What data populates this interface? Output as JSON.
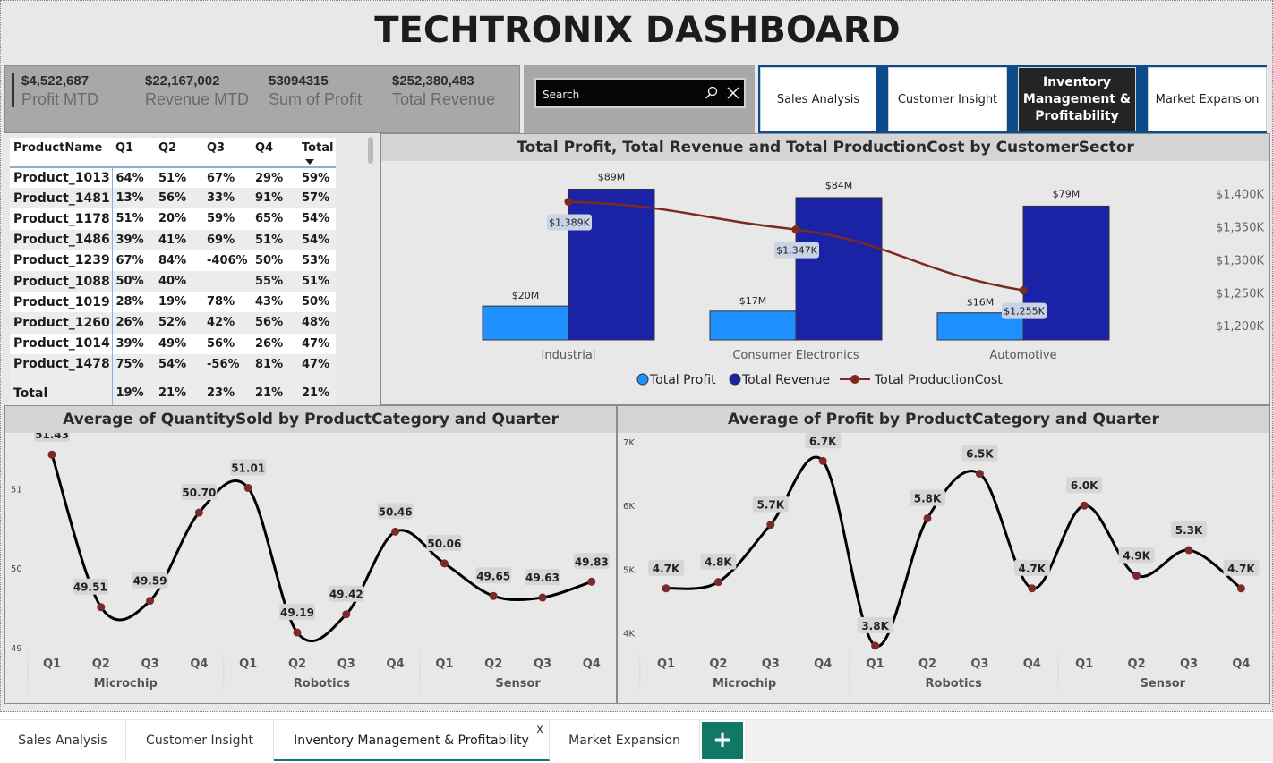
{
  "title": "TECHTRONIX DASHBOARD",
  "kpis": [
    {
      "value": "$4,522,687",
      "label": "Profit MTD"
    },
    {
      "value": "$22,167,002",
      "label": "Revenue MTD"
    },
    {
      "value": "53094315",
      "label": "Sum of Profit"
    },
    {
      "value": "$252,380,483",
      "label": "Total Revenue"
    }
  ],
  "search": {
    "placeholder": "Search",
    "search_icon": "search-icon",
    "clear_icon": "close-icon"
  },
  "nav": [
    "Sales Analysis",
    "Customer Insight",
    "Inventory Management & Profitability",
    "Market Expansion"
  ],
  "nav_active": "Inventory Management & Profitability",
  "matrix": {
    "headers": [
      "ProductName",
      "Q1",
      "Q2",
      "Q3",
      "Q4",
      "Total"
    ],
    "rows": [
      [
        "Product_1013",
        "64%",
        "51%",
        "67%",
        "29%",
        "59%"
      ],
      [
        "Product_1481",
        "13%",
        "56%",
        "33%",
        "91%",
        "57%"
      ],
      [
        "Product_1178",
        "51%",
        "20%",
        "59%",
        "65%",
        "54%"
      ],
      [
        "Product_1486",
        "39%",
        "41%",
        "69%",
        "51%",
        "54%"
      ],
      [
        "Product_1239",
        "67%",
        "84%",
        "-406%",
        "50%",
        "53%"
      ],
      [
        "Product_1088",
        "50%",
        "40%",
        "",
        "55%",
        "51%"
      ],
      [
        "Product_1019",
        "28%",
        "19%",
        "78%",
        "43%",
        "50%"
      ],
      [
        "Product_1260",
        "26%",
        "52%",
        "42%",
        "56%",
        "48%"
      ],
      [
        "Product_1014",
        "39%",
        "49%",
        "56%",
        "26%",
        "47%"
      ],
      [
        "Product_1478",
        "75%",
        "54%",
        "-56%",
        "81%",
        "47%"
      ]
    ],
    "total": [
      "Total",
      "19%",
      "21%",
      "23%",
      "21%",
      "21%"
    ],
    "sort_icon": "sort-desc-icon"
  },
  "chart_data": [
    {
      "type": "bar",
      "title": "Total Profit, Total Revenue and Total ProductionCost by CustomerSector",
      "categories": [
        "Industrial",
        "Consumer Electronics",
        "Automotive"
      ],
      "series": [
        {
          "name": "Total Profit",
          "kind": "bar",
          "values": [
            20,
            17,
            16
          ],
          "labels": [
            "$20M",
            "$17M",
            "$16M"
          ],
          "color": "#1e90ff"
        },
        {
          "name": "Total Revenue",
          "kind": "bar",
          "values": [
            89,
            84,
            79
          ],
          "labels": [
            "$89M",
            "$84M",
            "$79M"
          ],
          "color": "#1a23a6"
        },
        {
          "name": "Total ProductionCost",
          "kind": "line",
          "axis": "right",
          "values": [
            1389,
            1347,
            1255
          ],
          "labels": [
            "$1,389K",
            "$1,347K",
            "$1,255K"
          ],
          "color": "#7a2a1e"
        }
      ],
      "ylim": [
        0,
        94
      ],
      "y2ticks": [
        "$1,400K",
        "$1,350K",
        "$1,300K",
        "$1,250K",
        "$1,200K"
      ],
      "y2lim": [
        1180,
        1410
      ],
      "legend": "bottom"
    },
    {
      "type": "line",
      "title": "Average of QuantitySold by ProductCategory and Quarter",
      "categories": [
        "Q1",
        "Q2",
        "Q3",
        "Q4",
        "Q1",
        "Q2",
        "Q3",
        "Q4",
        "Q1",
        "Q2",
        "Q3",
        "Q4"
      ],
      "groups": [
        "Microchip",
        "Robotics",
        "Sensor"
      ],
      "values": [
        51.43,
        49.51,
        49.59,
        50.7,
        51.01,
        49.19,
        49.42,
        50.46,
        50.06,
        49.65,
        49.63,
        49.83
      ],
      "labels": [
        "51.43",
        "49.51",
        "49.59",
        "50.70",
        "51.01",
        "49.19",
        "49.42",
        "50.46",
        "50.06",
        "49.65",
        "49.63",
        "49.83"
      ],
      "yticks": [
        "51",
        "50",
        "49"
      ],
      "ylim": [
        49,
        51.5
      ]
    },
    {
      "type": "line",
      "title": "Average of Profit by ProductCategory and Quarter",
      "categories": [
        "Q1",
        "Q2",
        "Q3",
        "Q4",
        "Q1",
        "Q2",
        "Q3",
        "Q4",
        "Q1",
        "Q2",
        "Q3",
        "Q4"
      ],
      "groups": [
        "Microchip",
        "Robotics",
        "Sensor"
      ],
      "values": [
        4.7,
        4.8,
        5.7,
        6.7,
        3.8,
        5.8,
        6.5,
        4.7,
        6.0,
        4.9,
        5.3,
        4.7
      ],
      "labels": [
        "4.7K",
        "4.8K",
        "5.7K",
        "6.7K",
        "3.8K",
        "5.8K",
        "6.5K",
        "4.7K",
        "6.0K",
        "4.9K",
        "5.3K",
        "4.7K"
      ],
      "yticks": [
        "7K",
        "6K",
        "5K",
        "4K"
      ],
      "ylim": [
        3.7,
        7
      ]
    }
  ],
  "tabs": [
    "Sales Analysis",
    "Customer Insight",
    "Inventory Management & Profitability",
    "Market Expansion"
  ],
  "tab_active_index": 2,
  "tab_close": "x",
  "tab_add": "+"
}
